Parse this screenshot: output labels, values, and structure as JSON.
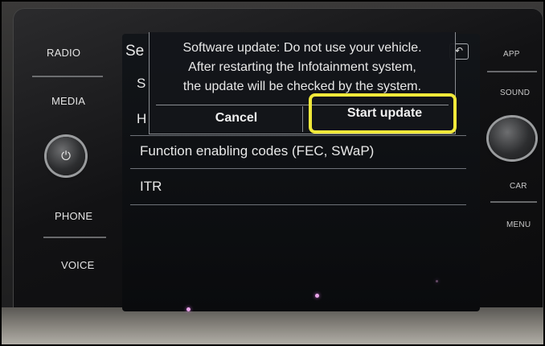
{
  "left_panel": {
    "radio": "RADIO",
    "media": "MEDIA",
    "phone": "PHONE",
    "voice": "VOICE"
  },
  "right_panel": {
    "app": "APP",
    "sound": "SOUND",
    "car": "CAR",
    "menu": "MENU"
  },
  "menu": {
    "title_partial": "Se",
    "row1_partial": "S",
    "row2_partial": "H",
    "row3": "Function enabling codes (FEC, SWaP)",
    "row4": "ITR"
  },
  "dialog": {
    "line1": "Software update: Do not use your vehicle.",
    "line2": "After restarting the Infotainment system,",
    "line3": "the update will be checked by the system.",
    "cancel_label": "Cancel",
    "start_label": "Start update"
  },
  "icons": {
    "back": "back-arrow-icon",
    "knob_left": "power-icon",
    "highlight_color": "#f1e93a"
  }
}
